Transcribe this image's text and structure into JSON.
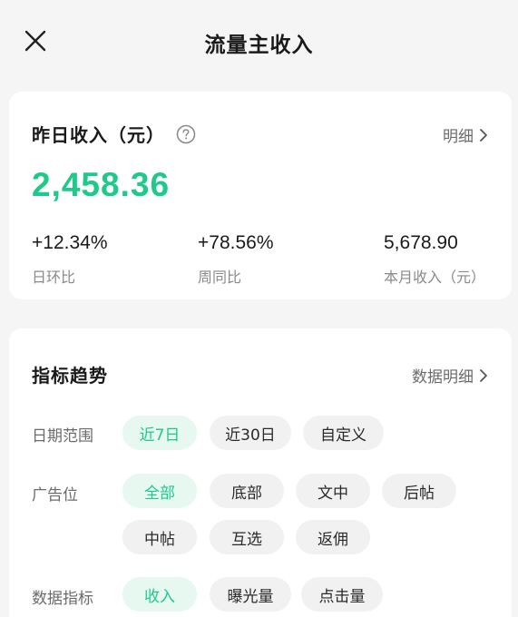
{
  "header": {
    "title": "流量主收入"
  },
  "summary": {
    "title": "昨日收入（元）",
    "detail_label": "明细",
    "amount": "2,458.36",
    "stats": [
      {
        "value": "+12.34%",
        "label": "日环比"
      },
      {
        "value": "+78.56%",
        "label": "周同比"
      },
      {
        "value": "5,678.90",
        "label": "本月收入（元）"
      }
    ]
  },
  "trend": {
    "title": "指标趋势",
    "detail_label": "数据明细",
    "date_range": {
      "label": "日期范围",
      "options": [
        "近7日",
        "近30日",
        "自定义"
      ]
    },
    "ad_slot": {
      "label": "广告位",
      "options": [
        "全部",
        "底部",
        "文中",
        "后帖",
        "中帖",
        "互选",
        "返佣"
      ]
    },
    "metric": {
      "label": "数据指标",
      "options": [
        "收入",
        "曝光量",
        "点击量"
      ]
    }
  },
  "colors": {
    "accent": "#1ec98a",
    "active_chip_bg": "#e7f8f0",
    "chip_bg": "#f1f1f1",
    "page_bg": "#f5f5f5"
  },
  "icons": {
    "close": "close-icon",
    "help": "question-circle-icon",
    "chevron": "chevron-right-icon"
  }
}
